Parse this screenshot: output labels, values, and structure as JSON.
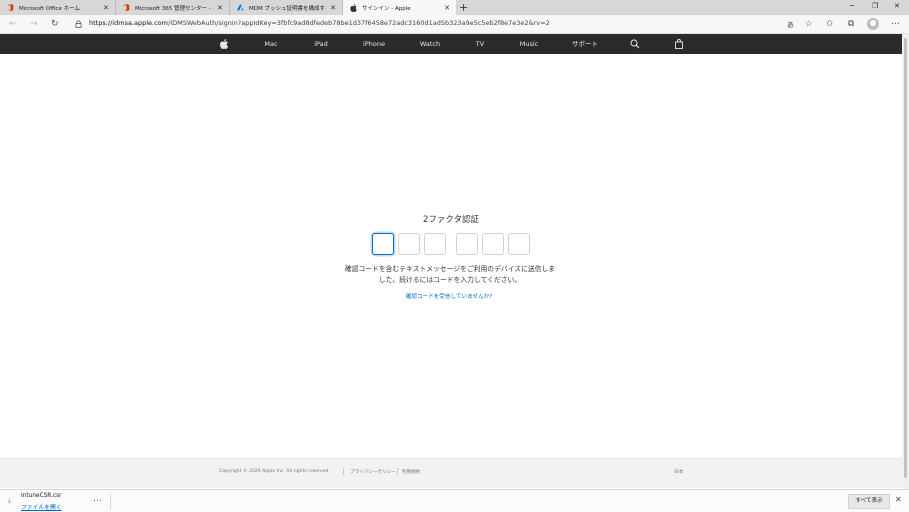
{
  "browser": {
    "tabs": [
      {
        "title": "Microsoft Office ホーム",
        "icon": "office-icon",
        "color": "#d83b01"
      },
      {
        "title": "Microsoft 365 管理センター - ホー…",
        "icon": "office-icon",
        "color": "#d83b01"
      },
      {
        "title": "MDM プッシュ証明書を構成する - I…",
        "icon": "azure-icon",
        "color": "#0078d4"
      },
      {
        "title": "サインイン - Apple",
        "icon": "apple-icon",
        "active": true
      }
    ],
    "new_tab": "+",
    "tab_close": "✕",
    "window": {
      "minimize": "─",
      "maximize": "❐",
      "close": "✕"
    },
    "url_host": "https://idmsa.apple.com",
    "url_path": "/IDMSWebAuth/signin?appIdKey=3fbfc9ad8dfedeb78be1d37f6458e72adc3160d1ad5b323a9e5c5eb2f8e7e3e2&rv=2"
  },
  "apple_nav": {
    "items": [
      "Mac",
      "iPad",
      "iPhone",
      "Watch",
      "TV",
      "Music",
      "サポート"
    ]
  },
  "auth": {
    "title": "2ファクタ認証",
    "digit_count": 6,
    "description_line1": "確認コードを含むテキストメッセージをご利用のデバイスに送信しま",
    "description_line2": "した。続けるにはコードを入力してください。",
    "help_link": "確認コードを受信していませんか?"
  },
  "footer": {
    "copyright": "Copyright © 2020 Apple Inc. All rights reserved.",
    "privacy": "プライバシーポリシー",
    "terms": "利用規約",
    "region": "日本"
  },
  "downloads": {
    "file_name": "IntuneCSR.csr",
    "open_label": "ファイルを開く",
    "more": "…",
    "show_all": "すべて表示",
    "close": "✕"
  },
  "colors": {
    "apple_nav_bg": "#2b2b2b",
    "link": "#0070c9",
    "focus": "#0070c9"
  }
}
